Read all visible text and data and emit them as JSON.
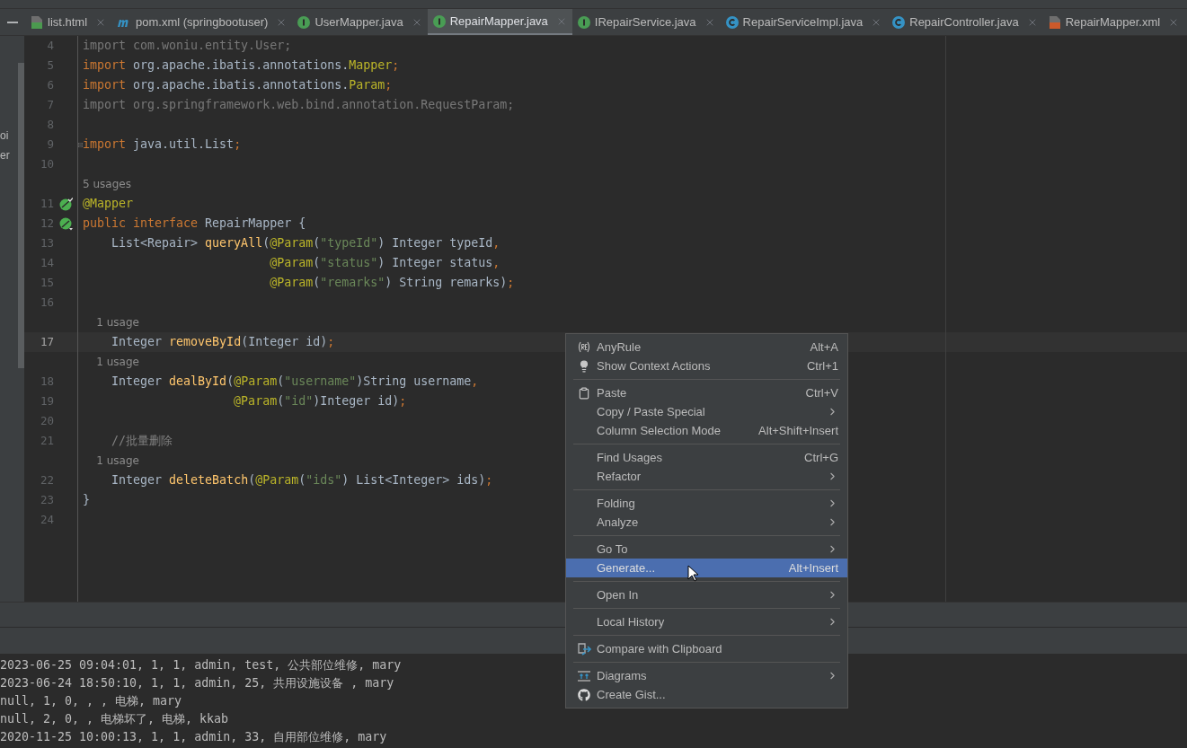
{
  "tabs": [
    {
      "label": "list.html",
      "kind": "html",
      "selected": false
    },
    {
      "label": "pom.xml (springbootuser)",
      "kind": "maven",
      "selected": false
    },
    {
      "label": "UserMapper.java",
      "kind": "interface",
      "selected": false
    },
    {
      "label": "RepairMapper.java",
      "kind": "interface",
      "selected": true
    },
    {
      "label": "IRepairService.java",
      "kind": "interface",
      "selected": false
    },
    {
      "label": "RepairServiceImpl.java",
      "kind": "class",
      "selected": false
    },
    {
      "label": "RepairController.java",
      "kind": "class",
      "selected": false
    },
    {
      "label": "RepairMapper.xml",
      "kind": "xml",
      "selected": false
    }
  ],
  "project_panel": {
    "items": [
      "oi",
      "er"
    ]
  },
  "editor": {
    "lines": [
      {
        "kind": "code",
        "number": "4",
        "current": false,
        "fold": false,
        "tokens": [
          {
            "kind": "unused",
            "text": "import com.woniu.entity.User;"
          }
        ]
      },
      {
        "kind": "code",
        "number": "5",
        "current": false,
        "fold": false,
        "tokens": [
          {
            "kind": "keyword",
            "text": "import"
          },
          {
            "kind": "plain",
            "text": " org.apache.ibatis.annotations."
          },
          {
            "kind": "annotation",
            "text": "Mapper"
          },
          {
            "kind": "keyword",
            "text": ";"
          }
        ]
      },
      {
        "kind": "code",
        "number": "6",
        "current": false,
        "fold": false,
        "tokens": [
          {
            "kind": "keyword",
            "text": "import"
          },
          {
            "kind": "plain",
            "text": " org.apache.ibatis.annotations."
          },
          {
            "kind": "annotation",
            "text": "Param"
          },
          {
            "kind": "keyword",
            "text": ";"
          }
        ]
      },
      {
        "kind": "code",
        "number": "7",
        "current": false,
        "fold": false,
        "tokens": [
          {
            "kind": "unused",
            "text": "import org.springframework.web.bind.annotation.RequestParam;"
          }
        ]
      },
      {
        "kind": "code",
        "number": "8",
        "current": false,
        "fold": false
      },
      {
        "kind": "code",
        "number": "9",
        "current": false,
        "fold": true,
        "tokens": [
          {
            "kind": "keyword",
            "text": "import"
          },
          {
            "kind": "plain",
            "text": " java.util.List"
          },
          {
            "kind": "keyword",
            "text": ";"
          }
        ]
      },
      {
        "kind": "code",
        "number": "10",
        "current": false,
        "fold": false
      },
      {
        "kind": "hint",
        "text": "5 usages"
      },
      {
        "kind": "mapper_implemented",
        "number": "11",
        "current": false,
        "fold": false,
        "tokens": [
          {
            "kind": "annotation",
            "text": "@Mapper"
          }
        ]
      },
      {
        "kind": "mapper_implementing",
        "number": "12",
        "current": false,
        "fold": false,
        "tokens": [
          {
            "kind": "keyword",
            "text": "public interface"
          },
          {
            "kind": "plain",
            "text": " RepairMapper {"
          }
        ]
      },
      {
        "kind": "code",
        "number": "13",
        "current": false,
        "fold": false,
        "tokens": [
          {
            "kind": "plain",
            "text": "    List<Repair> "
          },
          {
            "kind": "method",
            "text": "queryAll"
          },
          {
            "kind": "plain",
            "text": "("
          },
          {
            "kind": "annotation",
            "text": "@Param"
          },
          {
            "kind": "plain",
            "text": "("
          },
          {
            "kind": "string",
            "text": "\"typeId\""
          },
          {
            "kind": "plain",
            "text": ") Integer typeId"
          },
          {
            "kind": "keyword",
            "text": ","
          }
        ]
      },
      {
        "kind": "code",
        "number": "14",
        "current": false,
        "fold": false,
        "tokens": [
          {
            "kind": "annotation",
            "text": "                          @Param"
          },
          {
            "kind": "plain",
            "text": "("
          },
          {
            "kind": "string",
            "text": "\"status\""
          },
          {
            "kind": "plain",
            "text": ") Integer status"
          },
          {
            "kind": "keyword",
            "text": ","
          }
        ]
      },
      {
        "kind": "code",
        "number": "15",
        "current": false,
        "fold": false,
        "tokens": [
          {
            "kind": "annotation",
            "text": "                          @Param"
          },
          {
            "kind": "plain",
            "text": "("
          },
          {
            "kind": "string",
            "text": "\"remarks\""
          },
          {
            "kind": "plain",
            "text": ") String remarks)"
          },
          {
            "kind": "keyword",
            "text": ";"
          }
        ]
      },
      {
        "kind": "code",
        "number": "16",
        "current": false,
        "fold": false
      },
      {
        "kind": "hint",
        "text": "    1 usage"
      },
      {
        "kind": "code",
        "number": "17",
        "current": true,
        "fold": false,
        "tokens": [
          {
            "kind": "plain",
            "text": "    Integer "
          },
          {
            "kind": "method",
            "text": "removeById"
          },
          {
            "kind": "plain",
            "text": "(Integer id)"
          },
          {
            "kind": "keyword",
            "text": ";"
          }
        ]
      },
      {
        "kind": "hint",
        "text": "    1 usage"
      },
      {
        "kind": "code",
        "number": "18",
        "current": false,
        "fold": false,
        "tokens": [
          {
            "kind": "plain",
            "text": "    Integer "
          },
          {
            "kind": "method",
            "text": "dealById"
          },
          {
            "kind": "plain",
            "text": "("
          },
          {
            "kind": "annotation",
            "text": "@Param"
          },
          {
            "kind": "plain",
            "text": "("
          },
          {
            "kind": "string",
            "text": "\"username\""
          },
          {
            "kind": "plain",
            "text": ")String username"
          },
          {
            "kind": "keyword",
            "text": ","
          }
        ]
      },
      {
        "kind": "code",
        "number": "19",
        "current": false,
        "fold": false,
        "tokens": [
          {
            "kind": "annotation",
            "text": "                     @Param"
          },
          {
            "kind": "plain",
            "text": "("
          },
          {
            "kind": "string",
            "text": "\"id\""
          },
          {
            "kind": "plain",
            "text": ")Integer id)"
          },
          {
            "kind": "keyword",
            "text": ";"
          }
        ]
      },
      {
        "kind": "code",
        "number": "20",
        "current": false,
        "fold": false
      },
      {
        "kind": "code",
        "number": "21",
        "current": false,
        "fold": false,
        "tokens": [
          {
            "kind": "comment",
            "text": "    //批量删除"
          }
        ]
      },
      {
        "kind": "hint",
        "text": "    1 usage"
      },
      {
        "kind": "code",
        "number": "22",
        "current": false,
        "fold": false,
        "tokens": [
          {
            "kind": "plain",
            "text": "    Integer "
          },
          {
            "kind": "method",
            "text": "deleteBatch"
          },
          {
            "kind": "plain",
            "text": "("
          },
          {
            "kind": "annotation",
            "text": "@Param"
          },
          {
            "kind": "plain",
            "text": "("
          },
          {
            "kind": "string",
            "text": "\"ids\""
          },
          {
            "kind": "plain",
            "text": ") List<Integer> ids)"
          },
          {
            "kind": "keyword",
            "text": ";"
          }
        ]
      },
      {
        "kind": "code",
        "number": "23",
        "current": false,
        "fold": false,
        "tokens": [
          {
            "kind": "plain",
            "text": "}"
          }
        ]
      },
      {
        "kind": "code",
        "number": "24",
        "current": false,
        "fold": false
      }
    ]
  },
  "context_menu": {
    "groups": [
      [
        {
          "kind": "regex",
          "label": "AnyRule",
          "shortcut": "Alt+A",
          "submenu": false,
          "selected": false
        },
        {
          "kind": "bulb",
          "label": "Show Context Actions",
          "shortcut": "Ctrl+1",
          "submenu": false,
          "selected": false
        }
      ],
      [
        {
          "kind": "clipboard",
          "label": "Paste",
          "shortcut": "Ctrl+V",
          "submenu": false,
          "selected": false
        },
        {
          "kind": "plain",
          "label": "Copy / Paste Special",
          "submenu": true,
          "selected": false
        },
        {
          "kind": "plain",
          "label": "Column Selection Mode",
          "shortcut": "Alt+Shift+Insert",
          "submenu": false,
          "selected": false
        }
      ],
      [
        {
          "kind": "plain",
          "label": "Find Usages",
          "shortcut": "Ctrl+G",
          "submenu": false,
          "selected": false
        },
        {
          "kind": "plain",
          "label": "Refactor",
          "submenu": true,
          "selected": false
        }
      ],
      [
        {
          "kind": "plain",
          "label": "Folding",
          "submenu": true,
          "selected": false
        },
        {
          "kind": "plain",
          "label": "Analyze",
          "submenu": true,
          "selected": false
        }
      ],
      [
        {
          "kind": "plain",
          "label": "Go To",
          "submenu": true,
          "selected": false
        },
        {
          "kind": "plain",
          "label": "Generate...",
          "shortcut": "Alt+Insert",
          "submenu": false,
          "selected": true
        }
      ],
      [
        {
          "kind": "plain",
          "label": "Open In",
          "submenu": true,
          "selected": false
        }
      ],
      [
        {
          "kind": "plain",
          "label": "Local History",
          "submenu": true,
          "selected": false
        }
      ],
      [
        {
          "kind": "compare",
          "label": "Compare with Clipboard",
          "submenu": false,
          "selected": false
        }
      ],
      [
        {
          "kind": "diagram",
          "label": "Diagrams",
          "submenu": true,
          "selected": false
        },
        {
          "kind": "github",
          "label": "Create Gist...",
          "submenu": false,
          "selected": false
        }
      ]
    ]
  },
  "console": {
    "lines": [
      "2023-06-25 09:04:01, 1, 1, admin, test, 公共部位维修, mary",
      "2023-06-24 18:50:10, 1, 1, admin, 25, 共用设施设备 , mary",
      "null, 1, 0, , , 电梯, mary",
      "null, 2, 0, , 电梯坏了, 电梯, kkab",
      "2020-11-25 10:00:13, 1, 1, admin, 33, 自用部位维修, mary"
    ]
  }
}
